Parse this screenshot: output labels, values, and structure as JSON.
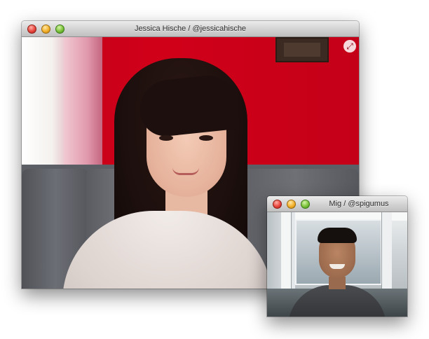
{
  "main_window": {
    "title": "Jessica Hische / @jessicahische",
    "controls": {
      "close": "close",
      "minimize": "minimize",
      "zoom": "zoom"
    },
    "fullscreen_icon": "expand-icon"
  },
  "pip_window": {
    "title": "Mig / @spigumus",
    "controls": {
      "close": "close",
      "minimize": "minimize",
      "zoom": "zoom"
    }
  },
  "colors": {
    "wall_red": "#c8001a",
    "titlebar": "#d6d6d6",
    "close": "#e8463d",
    "minimize": "#f2b02a",
    "zoom": "#7bc23a"
  }
}
